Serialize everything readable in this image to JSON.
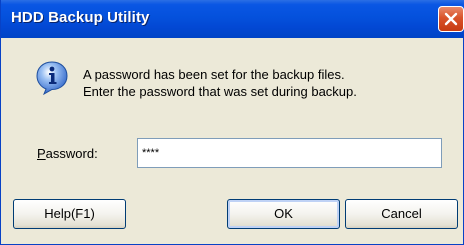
{
  "window": {
    "title": "HDD Backup Utility",
    "close_icon": "close-icon"
  },
  "message": {
    "icon": "info-icon",
    "line1": "A password has been set for the backup files.",
    "line2": "Enter the password that was set during backup."
  },
  "password": {
    "label_first": "P",
    "label_rest": "assword:",
    "value": "****"
  },
  "buttons": {
    "help": "Help(F1)",
    "ok": "OK",
    "cancel": "Cancel"
  },
  "colors": {
    "titlebar": "#0451dc",
    "close_button": "#d9532a",
    "dialog_background": "#ece9d8",
    "info_icon": "#3a73d6"
  }
}
